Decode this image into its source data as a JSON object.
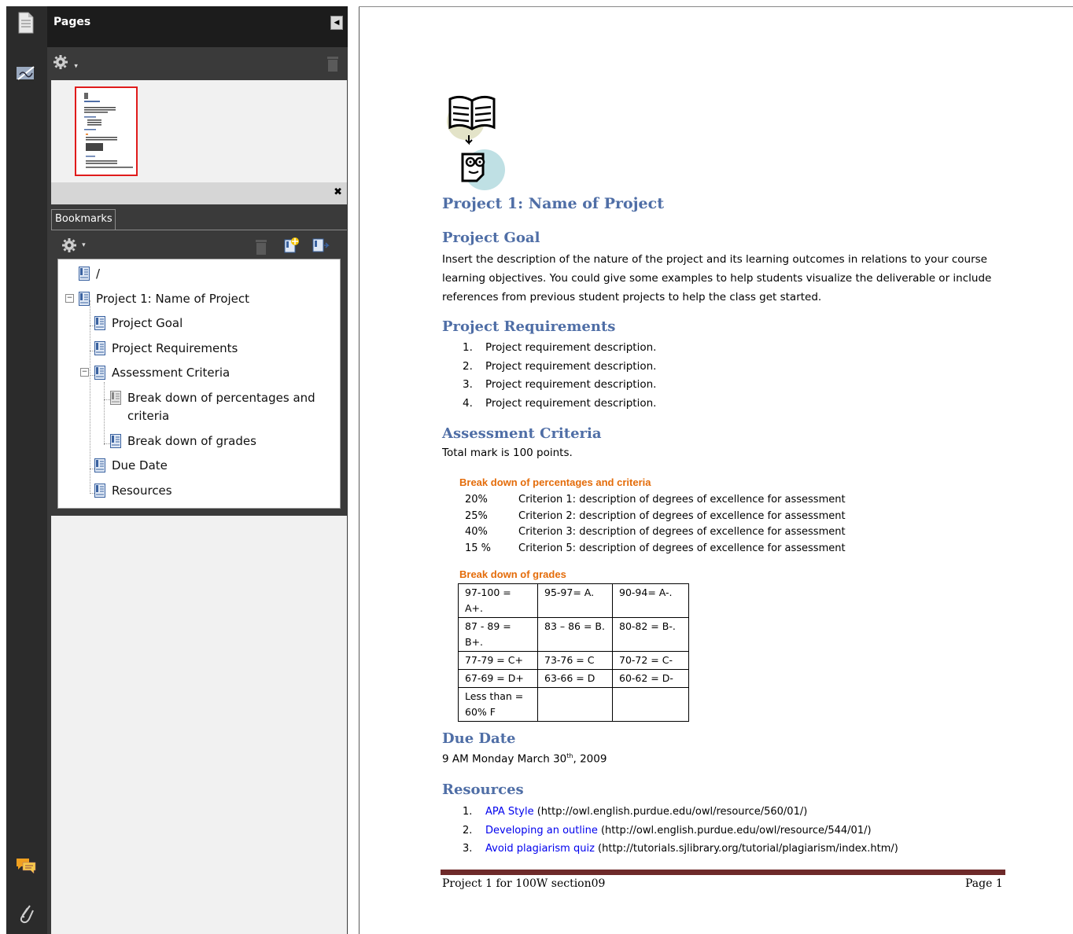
{
  "nav": {
    "pages_title": "Pages",
    "bookmarks_tab": "Bookmarks",
    "bookmarks": [
      {
        "label": "/"
      },
      {
        "label": "Project 1: Name of Project"
      },
      {
        "label": "Project Goal"
      },
      {
        "label": "Project Requirements"
      },
      {
        "label": "Assessment Criteria"
      },
      {
        "label": "Break down of percentages and criteria"
      },
      {
        "label": "Break down of grades"
      },
      {
        "label": "Due Date"
      },
      {
        "label": "Resources"
      }
    ]
  },
  "doc": {
    "title": "Project 1: Name of Project",
    "goal_heading": "Project Goal",
    "goal_lines": [
      "Insert the description of the nature of the project and its learning outcomes in relations to your course",
      "learning objectives. You could give some examples to help students visualize the deliverable or include",
      "references from previous student projects to help the class get started."
    ],
    "req_heading": "Project Requirements",
    "requirements": [
      {
        "num": "1.",
        "text": "Project requirement description."
      },
      {
        "num": "2.",
        "text": "Project requirement description."
      },
      {
        "num": "3.",
        "text": "Project requirement description."
      },
      {
        "num": "4.",
        "text": "Project requirement description."
      }
    ],
    "assess_heading": "Assessment Criteria",
    "total_mark": "Total mark is 100 points.",
    "breakdown_pct_heading": "Break down of percentages and criteria",
    "criteria": [
      {
        "pct": "20%",
        "text": "Criterion 1: description of degrees of excellence for assessment"
      },
      {
        "pct": "25%",
        "text": "Criterion 2: description of degrees of excellence for assessment"
      },
      {
        "pct": "40%",
        "text": "Criterion 3: description of degrees of excellence for assessment"
      },
      {
        "pct": "15 %",
        "text": "Criterion 5: description of degrees of excellence for assessment"
      }
    ],
    "breakdown_grades_heading": "Break down of grades",
    "grades": [
      [
        "97-100 = A+.",
        "95-97= A.",
        "90-94=  A-."
      ],
      [
        "87 - 89 = B+.",
        "83 – 86 = B.",
        "80-82 = B-."
      ],
      [
        "77-79 = C+",
        "73-76 = C",
        "70-72 = C-"
      ],
      [
        "67-69 = D+",
        "63-66 = D",
        "60-62 = D-"
      ],
      [
        "Less than = 60% F",
        "",
        ""
      ]
    ],
    "due_heading": "Due Date",
    "due_date_main": "9 AM Monday March 30",
    "due_date_sup": "th",
    "due_date_year": ", 2009",
    "resources_heading": "Resources",
    "resources": [
      {
        "num": "1.",
        "link": "APA Style",
        "url": "(http://owl.english.purdue.edu/owl/resource/560/01/)"
      },
      {
        "num": "2.",
        "link": "Developing an outline",
        "url": "(http://owl.english.purdue.edu/owl/resource/544/01/)"
      },
      {
        "num": "3.",
        "link": "Avoid plagiarism quiz",
        "url": "(http://tutorials.sjlibrary.org/tutorial/plagiarism/index.htm/)"
      }
    ],
    "footer_left": "Project 1 for 100W section09",
    "footer_right": "Page 1"
  },
  "colors": {
    "heading": "#4f6ea6",
    "orange": "#e46c0a",
    "link": "#0000ee",
    "footer_rule": "#6e2a2a",
    "thumb_border": "#e01b1b"
  }
}
